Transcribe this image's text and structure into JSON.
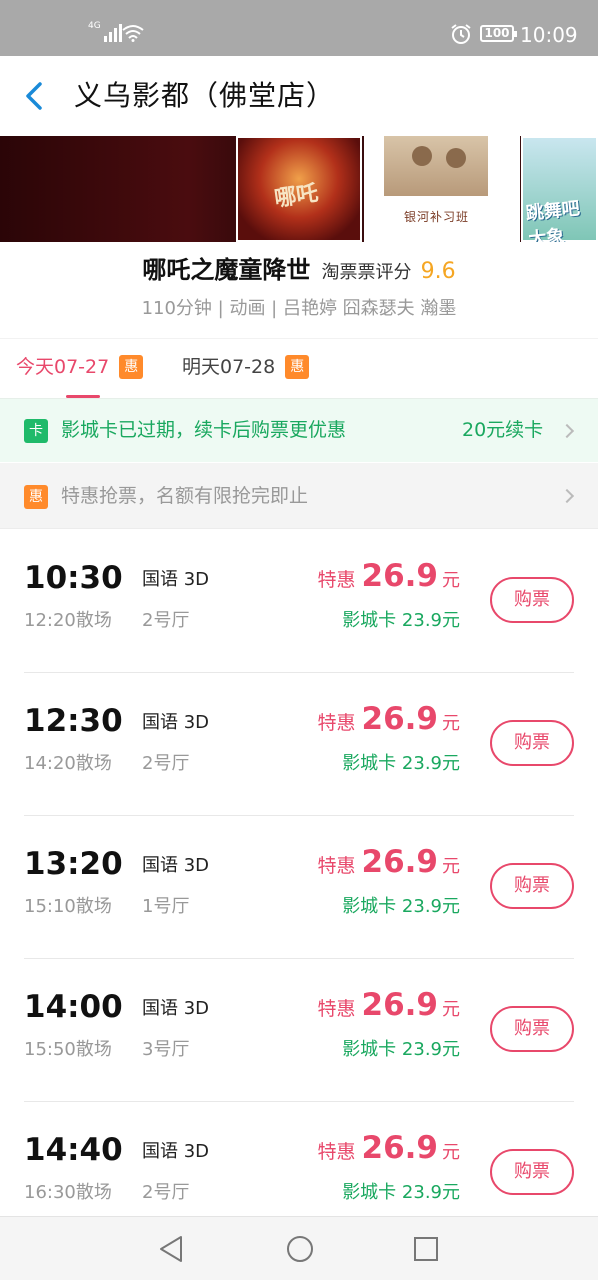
{
  "status_bar": {
    "network": "4G",
    "battery": "100",
    "time": "10:09",
    "icons": [
      "signal-icon",
      "wifi-icon",
      "alarm-icon",
      "battery-icon"
    ]
  },
  "header": {
    "title": "义乌影都（佛堂店）",
    "back_icon": "chevron-left-icon",
    "accent_color": "#1a8ad8"
  },
  "movie": {
    "name": "哪吒之魔童降世",
    "score_label": "淘票票评分",
    "score": "9.6",
    "meta": "110分钟 | 动画 | 吕艳婷 囧森瑟夫 瀚墨"
  },
  "posters": [
    {
      "text": ""
    },
    {
      "text": "哪吒"
    },
    {
      "text": "银河补习班"
    },
    {
      "text": "跳舞吧大象"
    }
  ],
  "date_tabs": [
    {
      "label": "今天07-27",
      "badge": "惠",
      "active": true
    },
    {
      "label": "明天07-28",
      "badge": "惠",
      "active": false
    }
  ],
  "card_banner": {
    "badge": "卡",
    "text": "影城卡已过期，续卡后购票更优惠",
    "action": "20元续卡"
  },
  "promo_banner": {
    "badge": "惠",
    "text": "特惠抢票，名额有限抢完即止"
  },
  "showtimes": [
    {
      "start": "10:30",
      "end": "12:20散场",
      "lang": "国语 3D",
      "hall": "2号厅",
      "price_label": "特惠",
      "price": "26.9",
      "unit": "元",
      "card_price": "影城卡 23.9元",
      "button": "购票"
    },
    {
      "start": "12:30",
      "end": "14:20散场",
      "lang": "国语 3D",
      "hall": "2号厅",
      "price_label": "特惠",
      "price": "26.9",
      "unit": "元",
      "card_price": "影城卡 23.9元",
      "button": "购票"
    },
    {
      "start": "13:20",
      "end": "15:10散场",
      "lang": "国语 3D",
      "hall": "1号厅",
      "price_label": "特惠",
      "price": "26.9",
      "unit": "元",
      "card_price": "影城卡 23.9元",
      "button": "购票"
    },
    {
      "start": "14:00",
      "end": "15:50散场",
      "lang": "国语 3D",
      "hall": "3号厅",
      "price_label": "特惠",
      "price": "26.9",
      "unit": "元",
      "card_price": "影城卡 23.9元",
      "button": "购票"
    },
    {
      "start": "14:40",
      "end": "16:30散场",
      "lang": "国语 3D",
      "hall": "2号厅",
      "price_label": "特惠",
      "price": "26.9",
      "unit": "元",
      "card_price": "影城卡 23.9元",
      "button": "购票"
    }
  ],
  "colors": {
    "pink": "#e8486b",
    "green": "#1aa85f",
    "orange": "#ff8a2b",
    "score": "#f5a623"
  },
  "system_nav": [
    "back-triangle-icon",
    "home-circle-icon",
    "recents-square-icon"
  ]
}
